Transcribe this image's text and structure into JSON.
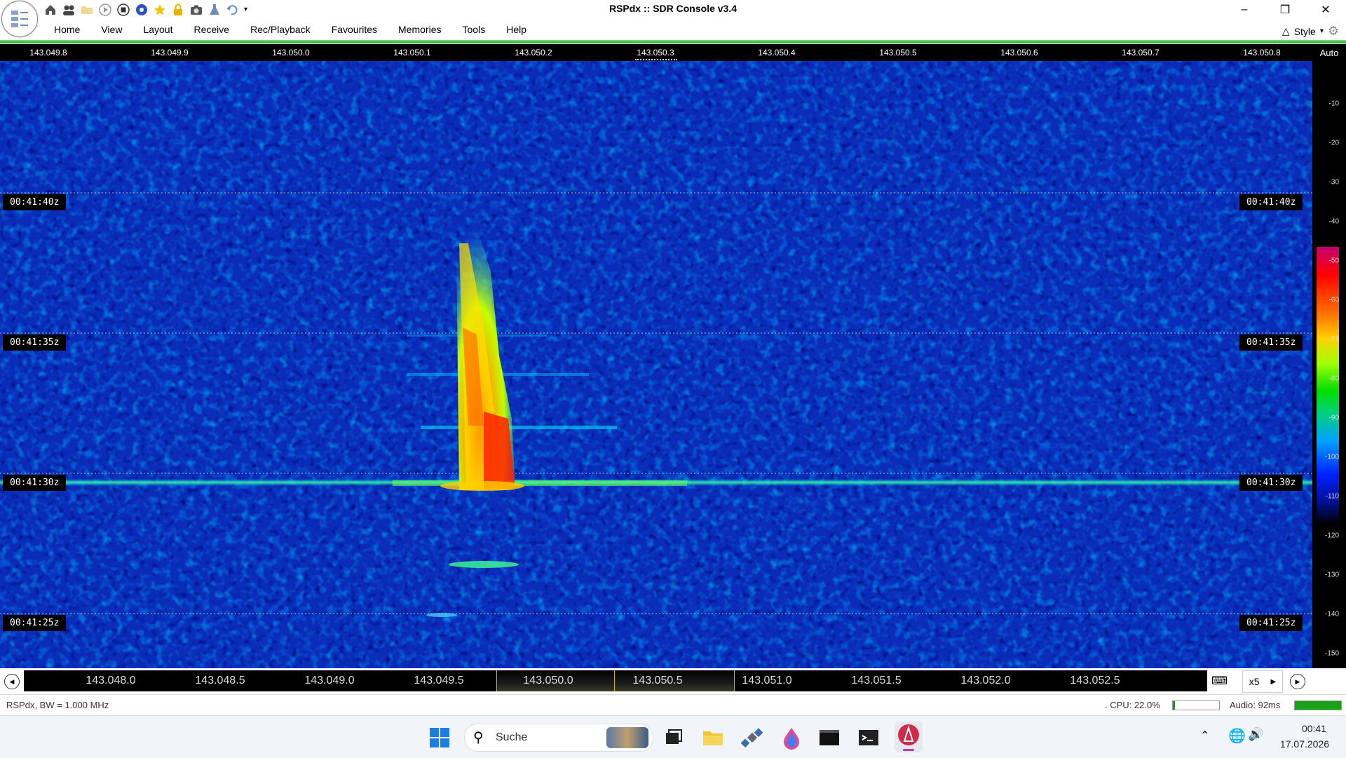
{
  "window": {
    "title": "RSPdx :: SDR Console v3.4",
    "controls": [
      "minimize-icon",
      "restore-icon",
      "close-icon"
    ]
  },
  "quick_access": [
    "home-icon",
    "users-icon",
    "folder-icon",
    "play-icon",
    "stop-icon",
    "record-icon",
    "star-icon",
    "lock-icon",
    "camera-icon",
    "flask-icon",
    "undo-icon",
    "dropdown-icon"
  ],
  "menu": {
    "items": [
      "Home",
      "View",
      "Layout",
      "Receive",
      "Rec/Playback",
      "Favourites",
      "Memories",
      "Tools",
      "Help"
    ],
    "style_label": "Style"
  },
  "spectrum": {
    "top_ticks": [
      "143.049.8",
      "143.049.9",
      "143.050.0",
      "143.050.1",
      "143.050.2",
      "143.050.3",
      "143.050.4",
      "143.050.5",
      "143.050.6",
      "143.050.7",
      "143.050.8"
    ],
    "auto_label": "Auto",
    "time_labels": [
      "00:41:40z",
      "00:41:35z",
      "00:41:30z",
      "00:41:25z"
    ],
    "scale_levels": [
      "-10",
      "-20",
      "-30",
      "-40",
      "-50",
      "-60",
      "-70",
      "-80",
      "-90",
      "-100",
      "-110",
      "-120",
      "-130",
      "-140",
      "-150"
    ],
    "bottom_ticks": [
      "143.048.0",
      "143.048.5",
      "143.049.0",
      "143.049.5",
      "143.050.0",
      "143.050.5",
      "143.051.0",
      "143.051.5",
      "143.052.0",
      "143.052.5"
    ],
    "zoom_label": "x5"
  },
  "status": {
    "device": "RSPdx, BW = 1.000 MHz",
    "cpu": ". CPU: 22.0%",
    "cpu_fraction": 0.05,
    "audio": "Audio: 92ms",
    "audio_fraction": 1.0
  },
  "taskbar": {
    "search_label": "Suche",
    "time": "00:41",
    "date": "17.07.2026",
    "apps": [
      "windows-start-icon",
      "file-explorer-icon",
      "folder-icon",
      "satellite-icon",
      "drop-icon",
      "terminal-icon",
      "terminal-icon",
      "sdr-console-icon"
    ]
  },
  "colors": {
    "waterfall_background": "#0a2cb8",
    "accent_green": "#28a028"
  }
}
